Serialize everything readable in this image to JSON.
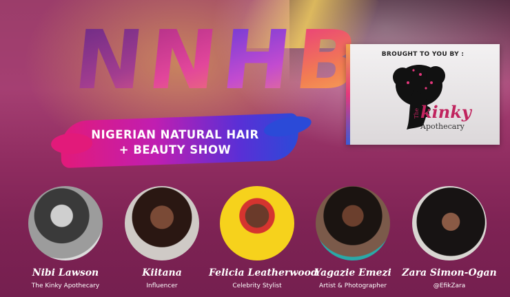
{
  "logo": {
    "letters": [
      "N",
      "N",
      "H",
      "B"
    ]
  },
  "show": {
    "line1": "NIGERIAN NATURAL HAIR",
    "line2": "+ BEAUTY SHOW"
  },
  "sponsor": {
    "label": "BROUGHT TO YOU BY :",
    "brand_prefix": "The",
    "brand_name": "kinky",
    "brand_sub": "Apothecary"
  },
  "speakers": [
    {
      "name": "Nibi Lawson",
      "role": "The Kinky Apothecary"
    },
    {
      "name": "Kiitana",
      "role": "Influencer"
    },
    {
      "name": "Felicia Leatherwood",
      "role": "Celebrity Stylist"
    },
    {
      "name": "Yagazie Emezi",
      "role": "Artist & Photographer"
    },
    {
      "name": "Zara Simon-Ogan",
      "role": "@EfikZara"
    }
  ],
  "colors": {
    "background": "#8f2c60",
    "brush_start": "#e21a7a",
    "brush_end": "#2b4ad8",
    "brand": "#c0245e"
  }
}
